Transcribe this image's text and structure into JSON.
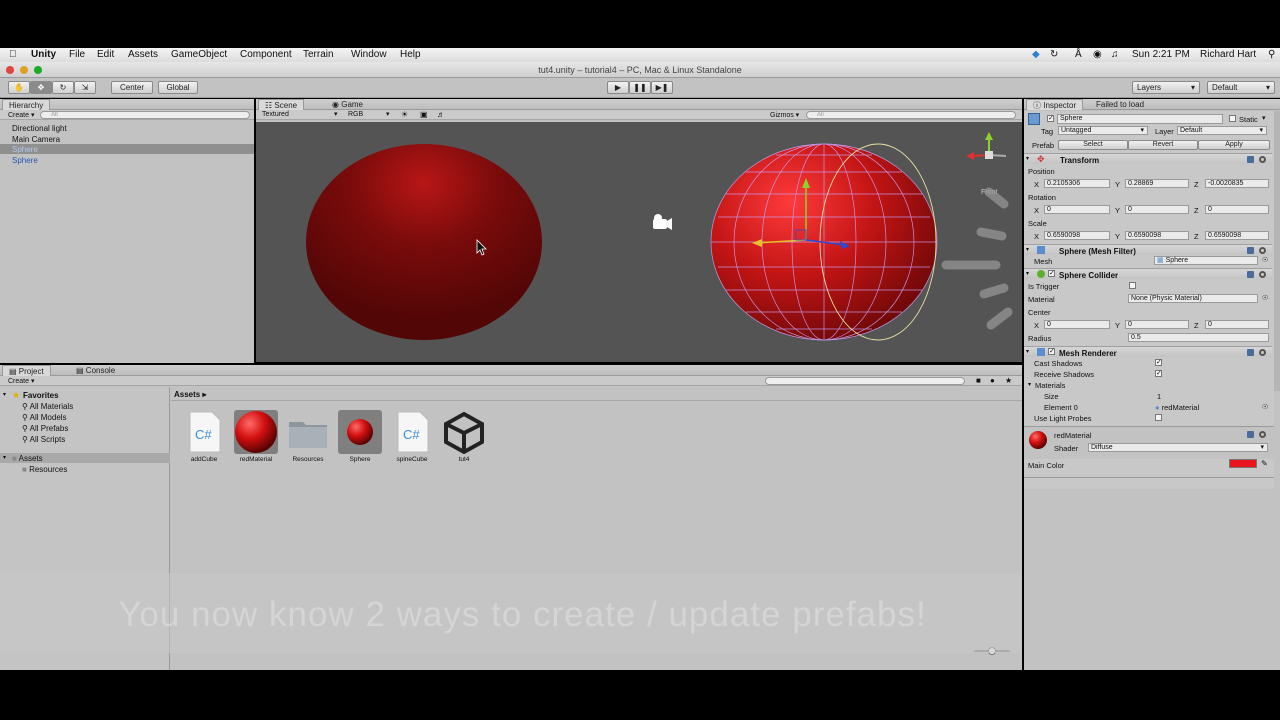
{
  "menubar": {
    "app": "Unity",
    "items": [
      "File",
      "Edit",
      "Assets",
      "GameObject",
      "Component",
      "Terrain",
      "Window",
      "Help"
    ],
    "clock": "Sun 2:21 PM",
    "user": "Richard Hart"
  },
  "window": {
    "title": "tut4.unity – tutorial4 – PC, Mac & Linux Standalone"
  },
  "toolbar": {
    "pivot": "Center",
    "space": "Global",
    "layers": "Layers",
    "layout": "Default"
  },
  "hierarchy": {
    "tab": "Hierarchy",
    "create": "Create",
    "search_placeholder": "All",
    "items": [
      "Directional light",
      "Main Camera",
      "Sphere",
      "Sphere"
    ]
  },
  "scene": {
    "tabs": [
      "Scene",
      "Game"
    ],
    "render_mode": "Textured",
    "color_mode": "RGB",
    "gizmos": "Gizmos",
    "search_placeholder": "All",
    "gizmo_label": "Front"
  },
  "project": {
    "tabs": [
      "Project",
      "Console"
    ],
    "create": "Create",
    "favorites_label": "Favorites",
    "favorites": [
      "All Materials",
      "All Models",
      "All Prefabs",
      "All Scripts"
    ],
    "assets_label": "Assets",
    "folders": [
      "Resources"
    ],
    "breadcrumb": "Assets",
    "assets": [
      "addCube",
      "redMaterial",
      "Resources",
      "Sphere",
      "spineCube",
      "tut4"
    ]
  },
  "inspector": {
    "tab": "Inspector",
    "failed": "Failed to load",
    "name": "Sphere",
    "static": "Static",
    "tag_label": "Tag",
    "tag_value": "Untagged",
    "layer_label": "Layer",
    "layer_value": "Default",
    "prefab_label": "Prefab",
    "prefab_select": "Select",
    "prefab_revert": "Revert",
    "prefab_apply": "Apply",
    "transform": {
      "title": "Transform",
      "position_label": "Position",
      "position": {
        "x": "0.2105306",
        "y": "0.28869",
        "z": "-0.0020835"
      },
      "rotation_label": "Rotation",
      "rotation": {
        "x": "0",
        "y": "0",
        "z": "0"
      },
      "scale_label": "Scale",
      "scale": {
        "x": "0.6590098",
        "y": "0.6590098",
        "z": "0.6590098"
      }
    },
    "mesh_filter": {
      "title": "Sphere (Mesh Filter)",
      "mesh_label": "Mesh",
      "mesh_value": "Sphere"
    },
    "collider": {
      "title": "Sphere Collider",
      "trigger_label": "Is Trigger",
      "material_label": "Material",
      "material_value": "None (Physic Material)",
      "center_label": "Center",
      "center": {
        "x": "0",
        "y": "0",
        "z": "0"
      },
      "radius_label": "Radius",
      "radius": "0.5"
    },
    "renderer": {
      "title": "Mesh Renderer",
      "cast_label": "Cast Shadows",
      "receive_label": "Receive Shadows",
      "materials_label": "Materials",
      "size_label": "Size",
      "size": "1",
      "element_label": "Element 0",
      "element_value": "redMaterial",
      "probes_label": "Use Light Probes"
    },
    "material": {
      "name": "redMaterial",
      "shader_label": "Shader",
      "shader_value": "Diffuse",
      "main_color_label": "Main Color",
      "main_color": "#e8141e"
    },
    "axis_labels": {
      "x": "X",
      "y": "Y",
      "z": "Z"
    }
  },
  "subtitle": "You now know 2 ways to create / update prefabs!",
  "colors": {
    "sphere_red": "#7a0c0c",
    "selection": "#3d6dcc"
  }
}
